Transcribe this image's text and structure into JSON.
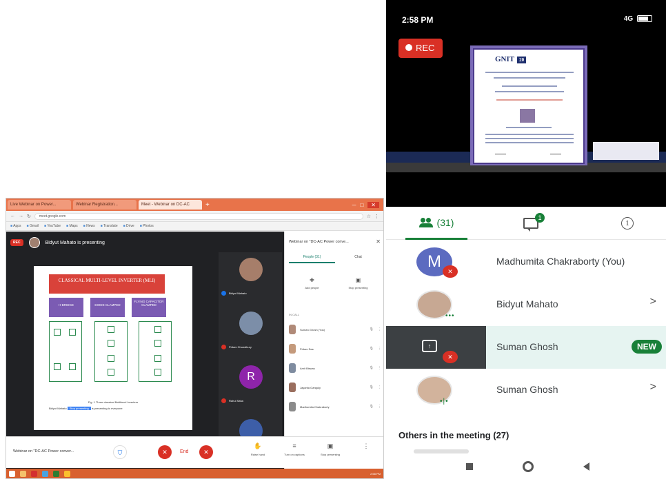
{
  "desktop": {
    "tabs": [
      {
        "label": "Live Webinar on Power..."
      },
      {
        "label": "Webinar Registration..."
      },
      {
        "label": "Meet - Webinar on DC-AC"
      }
    ],
    "url": "meet.google.com",
    "bookmarks": [
      "Apps",
      "Gmail",
      "YouTube",
      "Maps",
      "News",
      "Translate",
      "Drive",
      "Photos"
    ],
    "presenting_text": "Bidyut Mahato is presenting",
    "rec_label": "REC",
    "slide": {
      "title": "CLASSICAL MULTI-LEVEL INVERTER (MLI)",
      "boxes": [
        "H-BRIDGE",
        "DIODE CLAMPED",
        "FLYING CAPACITOR CLAMPED"
      ],
      "caption": "Fig. 1 Three classical Multilevel Inverters",
      "note_prefix": "Bidyut Mahato",
      "note_highlight": "Stop presenting",
      "note_suffix": "is presenting to everyone"
    },
    "tiles": [
      {
        "name": "Bidyut Mahato"
      },
      {
        "name": "Pritam Chowdhury"
      },
      {
        "name": "Rahul Saha",
        "letter": "R"
      },
      {
        "name": "Ujjwal Mondal"
      }
    ],
    "side_panel": {
      "title": "Webinar on \"DC-AC Power conve...",
      "tabs": [
        "People (31)",
        "Chat"
      ],
      "actions": [
        "Add people",
        "Stop presenting"
      ],
      "section": "IN CALL",
      "people": [
        "Suman Ghosh (You)",
        "Pritam Das",
        "Amit Biswas",
        "Jayanta Ganguly",
        "Madhumita Chakraborty"
      ]
    },
    "controls": {
      "meeting_title": "Webinar on \"DC-AC Power conver...",
      "end_label": "End",
      "items": [
        "Raise hand",
        "Turn on captions",
        "Stop presenting"
      ]
    },
    "taskbar_clock": "2:58 PM"
  },
  "phone": {
    "status_time": "2:58 PM",
    "status_right": "4G",
    "rec_label": "REC",
    "certificate": {
      "logo": "GNIT",
      "badge": "20"
    },
    "tabs": {
      "people_count": "(31)",
      "chat_badge": "1"
    },
    "participants": [
      {
        "name": "Madhumita Chakraborty (You)",
        "letter": "M"
      },
      {
        "name": "Bidyut Mahato"
      },
      {
        "name": "Suman Ghosh",
        "badge": "NEW"
      },
      {
        "name": "Suman Ghosh"
      }
    ],
    "others_heading": "Others in the meeting (27)"
  },
  "colors": {
    "accent_green": "#188038",
    "rec_red": "#d93025",
    "browser_orange": "#e8734a"
  }
}
